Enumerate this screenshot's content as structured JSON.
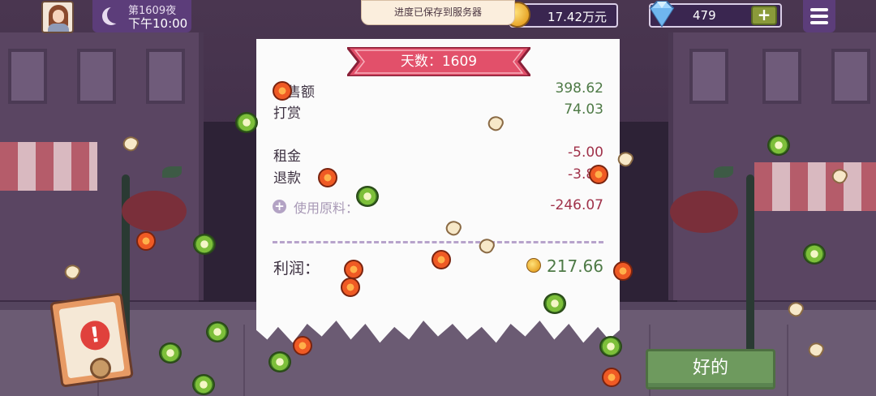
{
  "top_bar": {
    "day_label": "第1609夜",
    "time_label": "下午10:00",
    "toast": "进度已保存到服务器",
    "coins": "17.42万元",
    "gems": "479",
    "add_label": "+"
  },
  "receipt": {
    "title": "天数：1609",
    "rows": [
      {
        "label": "销售额",
        "value": "398.62",
        "kind": "pos"
      },
      {
        "label": "打赏",
        "value": "74.03",
        "kind": "pos"
      },
      {
        "label": "租金",
        "value": "-5.00",
        "kind": "neg"
      },
      {
        "label": "退款",
        "value": "-3.80",
        "kind": "neg"
      }
    ],
    "ingredients_label": "使用原料：",
    "ingredients_value": "-246.07",
    "profit_label": "利润：",
    "profit_value": "217.66"
  },
  "ok_button": "好的",
  "colors": {
    "positive": "#4e7a46",
    "negative": "#a0324a",
    "ribbon": "#e2506a",
    "accent_purple": "#5c3d7a"
  },
  "icons": [
    "moon-icon",
    "coin-icon",
    "diamond-icon",
    "menu-icon",
    "alert-icon",
    "plus-circle-icon"
  ]
}
